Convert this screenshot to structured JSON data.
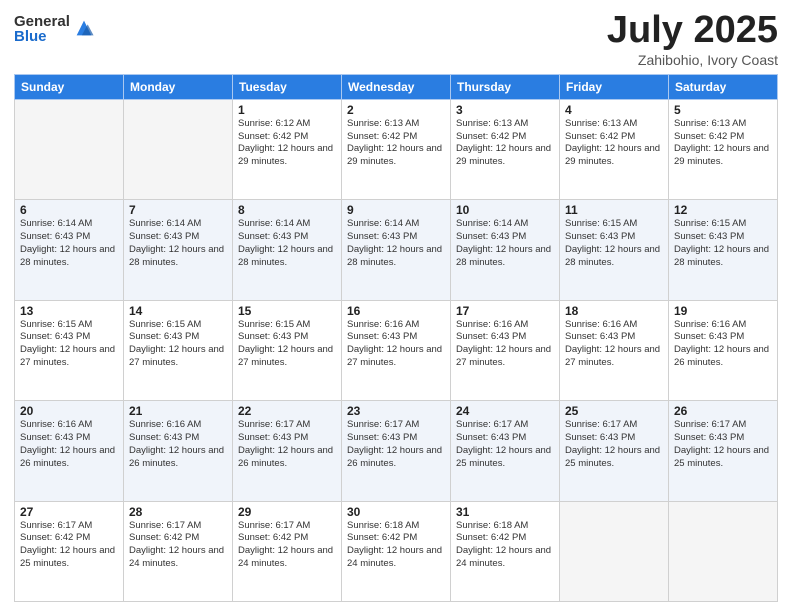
{
  "header": {
    "logo_general": "General",
    "logo_blue": "Blue",
    "month": "July 2025",
    "location": "Zahibohio, Ivory Coast"
  },
  "days_of_week": [
    "Sunday",
    "Monday",
    "Tuesday",
    "Wednesday",
    "Thursday",
    "Friday",
    "Saturday"
  ],
  "weeks": [
    [
      {
        "day": "",
        "info": ""
      },
      {
        "day": "",
        "info": ""
      },
      {
        "day": "1",
        "info": "Sunrise: 6:12 AM\nSunset: 6:42 PM\nDaylight: 12 hours and 29 minutes."
      },
      {
        "day": "2",
        "info": "Sunrise: 6:13 AM\nSunset: 6:42 PM\nDaylight: 12 hours and 29 minutes."
      },
      {
        "day": "3",
        "info": "Sunrise: 6:13 AM\nSunset: 6:42 PM\nDaylight: 12 hours and 29 minutes."
      },
      {
        "day": "4",
        "info": "Sunrise: 6:13 AM\nSunset: 6:42 PM\nDaylight: 12 hours and 29 minutes."
      },
      {
        "day": "5",
        "info": "Sunrise: 6:13 AM\nSunset: 6:42 PM\nDaylight: 12 hours and 29 minutes."
      }
    ],
    [
      {
        "day": "6",
        "info": "Sunrise: 6:14 AM\nSunset: 6:43 PM\nDaylight: 12 hours and 28 minutes."
      },
      {
        "day": "7",
        "info": "Sunrise: 6:14 AM\nSunset: 6:43 PM\nDaylight: 12 hours and 28 minutes."
      },
      {
        "day": "8",
        "info": "Sunrise: 6:14 AM\nSunset: 6:43 PM\nDaylight: 12 hours and 28 minutes."
      },
      {
        "day": "9",
        "info": "Sunrise: 6:14 AM\nSunset: 6:43 PM\nDaylight: 12 hours and 28 minutes."
      },
      {
        "day": "10",
        "info": "Sunrise: 6:14 AM\nSunset: 6:43 PM\nDaylight: 12 hours and 28 minutes."
      },
      {
        "day": "11",
        "info": "Sunrise: 6:15 AM\nSunset: 6:43 PM\nDaylight: 12 hours and 28 minutes."
      },
      {
        "day": "12",
        "info": "Sunrise: 6:15 AM\nSunset: 6:43 PM\nDaylight: 12 hours and 28 minutes."
      }
    ],
    [
      {
        "day": "13",
        "info": "Sunrise: 6:15 AM\nSunset: 6:43 PM\nDaylight: 12 hours and 27 minutes."
      },
      {
        "day": "14",
        "info": "Sunrise: 6:15 AM\nSunset: 6:43 PM\nDaylight: 12 hours and 27 minutes."
      },
      {
        "day": "15",
        "info": "Sunrise: 6:15 AM\nSunset: 6:43 PM\nDaylight: 12 hours and 27 minutes."
      },
      {
        "day": "16",
        "info": "Sunrise: 6:16 AM\nSunset: 6:43 PM\nDaylight: 12 hours and 27 minutes."
      },
      {
        "day": "17",
        "info": "Sunrise: 6:16 AM\nSunset: 6:43 PM\nDaylight: 12 hours and 27 minutes."
      },
      {
        "day": "18",
        "info": "Sunrise: 6:16 AM\nSunset: 6:43 PM\nDaylight: 12 hours and 27 minutes."
      },
      {
        "day": "19",
        "info": "Sunrise: 6:16 AM\nSunset: 6:43 PM\nDaylight: 12 hours and 26 minutes."
      }
    ],
    [
      {
        "day": "20",
        "info": "Sunrise: 6:16 AM\nSunset: 6:43 PM\nDaylight: 12 hours and 26 minutes."
      },
      {
        "day": "21",
        "info": "Sunrise: 6:16 AM\nSunset: 6:43 PM\nDaylight: 12 hours and 26 minutes."
      },
      {
        "day": "22",
        "info": "Sunrise: 6:17 AM\nSunset: 6:43 PM\nDaylight: 12 hours and 26 minutes."
      },
      {
        "day": "23",
        "info": "Sunrise: 6:17 AM\nSunset: 6:43 PM\nDaylight: 12 hours and 26 minutes."
      },
      {
        "day": "24",
        "info": "Sunrise: 6:17 AM\nSunset: 6:43 PM\nDaylight: 12 hours and 25 minutes."
      },
      {
        "day": "25",
        "info": "Sunrise: 6:17 AM\nSunset: 6:43 PM\nDaylight: 12 hours and 25 minutes."
      },
      {
        "day": "26",
        "info": "Sunrise: 6:17 AM\nSunset: 6:43 PM\nDaylight: 12 hours and 25 minutes."
      }
    ],
    [
      {
        "day": "27",
        "info": "Sunrise: 6:17 AM\nSunset: 6:42 PM\nDaylight: 12 hours and 25 minutes."
      },
      {
        "day": "28",
        "info": "Sunrise: 6:17 AM\nSunset: 6:42 PM\nDaylight: 12 hours and 24 minutes."
      },
      {
        "day": "29",
        "info": "Sunrise: 6:17 AM\nSunset: 6:42 PM\nDaylight: 12 hours and 24 minutes."
      },
      {
        "day": "30",
        "info": "Sunrise: 6:18 AM\nSunset: 6:42 PM\nDaylight: 12 hours and 24 minutes."
      },
      {
        "day": "31",
        "info": "Sunrise: 6:18 AM\nSunset: 6:42 PM\nDaylight: 12 hours and 24 minutes."
      },
      {
        "day": "",
        "info": ""
      },
      {
        "day": "",
        "info": ""
      }
    ]
  ]
}
